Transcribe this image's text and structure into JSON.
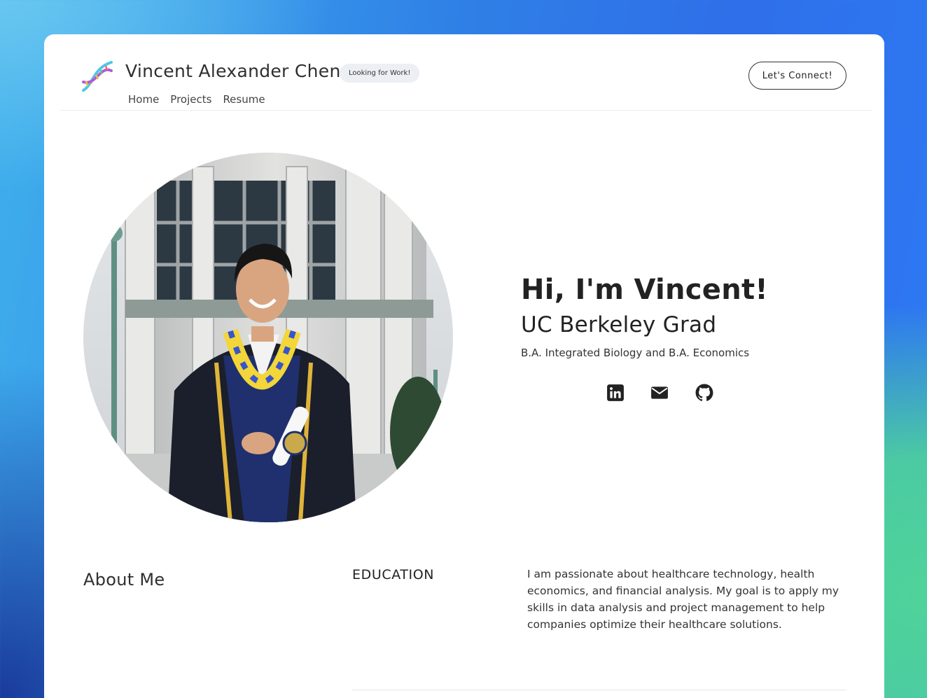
{
  "header": {
    "brand": "Vincent Alexander Chen",
    "status_badge": "Looking for Work!",
    "cta_label": "Let's Connect!",
    "nav": [
      "Home",
      "Projects",
      "Resume"
    ],
    "logo_icon": "dna-helix-icon"
  },
  "hero": {
    "greeting": "Hi, I'm Vincent!",
    "subtitle": "UC Berkeley Grad",
    "degree": "B.A. Integrated Biology and B.A. Economics",
    "photo": "graduation-portrait",
    "socials": [
      "linkedin-icon",
      "email-icon",
      "github-icon"
    ]
  },
  "about": {
    "title": "About Me",
    "section_heading": "EDUCATION",
    "body": "I am passionate about healthcare technology, health economics, and financial analysis. My goal is to apply my skills in data analysis and project management to help companies optimize their healthcare solutions."
  },
  "colors": {
    "bg_blue": "#2f7fe6",
    "bg_green": "#4fd39a",
    "text_dark": "#222222",
    "badge_bg": "#eceff3"
  }
}
